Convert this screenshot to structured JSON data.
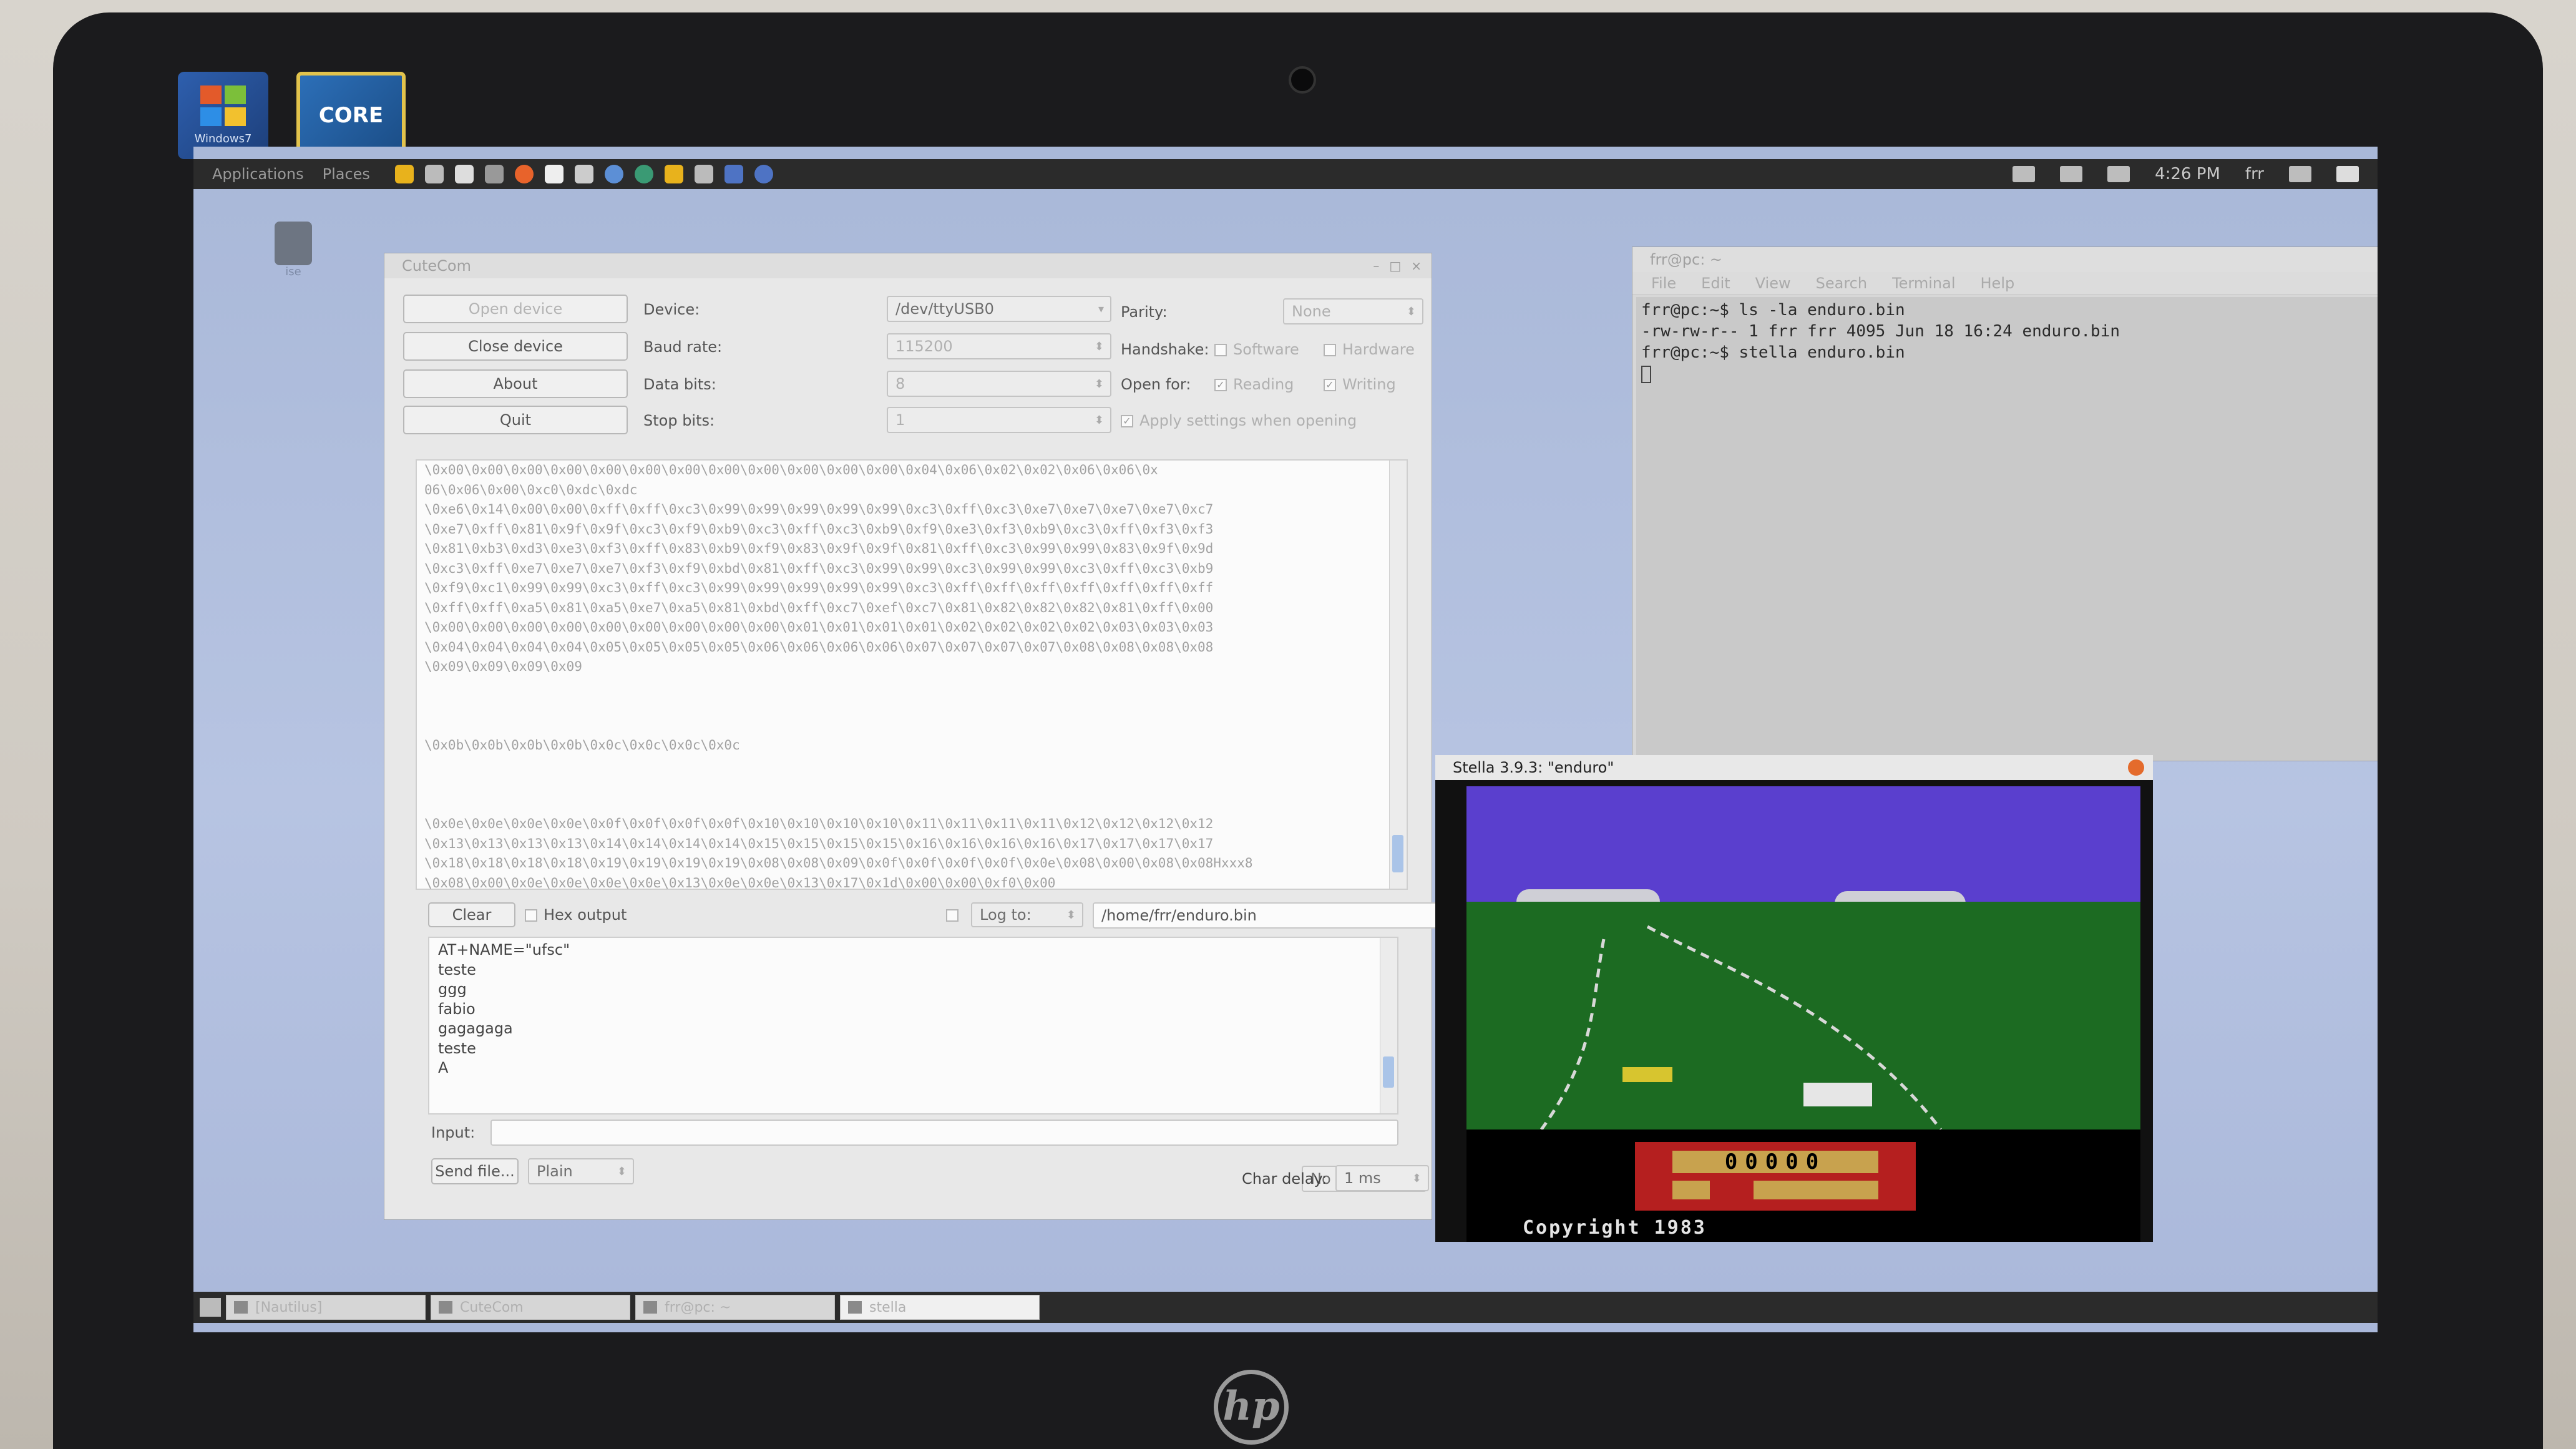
{
  "taskbar_top": {
    "applications": "Applications",
    "places": "Places",
    "clock": "4:26 PM",
    "user": "frr"
  },
  "desktop": {
    "windows7_label": "Windows7",
    "intel_label": "CORE",
    "desk_icon_label": "ise"
  },
  "cutecom": {
    "title": "CuteCom",
    "buttons": {
      "open_device": "Open device",
      "close_device": "Close device",
      "about": "About",
      "quit": "Quit"
    },
    "labels": {
      "device": "Device:",
      "baud_rate": "Baud rate:",
      "data_bits": "Data bits:",
      "stop_bits": "Stop bits:",
      "parity": "Parity:",
      "handshake": "Handshake:",
      "open_for": "Open for:"
    },
    "values": {
      "device": "/dev/ttyUSB0",
      "baud_rate": "115200",
      "data_bits": "8",
      "stop_bits": "1",
      "parity": "None"
    },
    "checkboxes": {
      "software": "Software",
      "hardware": "Hardware",
      "reading": "Reading",
      "writing": "Writing",
      "apply_settings": "Apply settings when opening"
    },
    "output_lines": [
      "\\0x00\\0x00\\0x00\\0x00\\0x00\\0x00\\0x00\\0x00\\0x00\\0x00\\0x00\\0x00\\0x04\\0x06\\0x02\\0x02\\0x06\\0x06\\0x",
      "06\\0x06\\0x00\\0xc0\\0xdc\\0xdc",
      "\\0xe6\\0x14\\0x00\\0x00\\0xff\\0xff\\0xc3\\0x99\\0x99\\0x99\\0x99\\0x99\\0xc3\\0xff\\0xc3\\0xe7\\0xe7\\0xe7\\0xe7\\0xc7",
      "\\0xe7\\0xff\\0x81\\0x9f\\0x9f\\0xc3\\0xf9\\0xb9\\0xc3\\0xff\\0xc3\\0xb9\\0xf9\\0xe3\\0xf3\\0xb9\\0xc3\\0xff\\0xf3\\0xf3",
      "\\0x81\\0xb3\\0xd3\\0xe3\\0xf3\\0xff\\0x83\\0xb9\\0xf9\\0x83\\0x9f\\0x9f\\0x81\\0xff\\0xc3\\0x99\\0x99\\0x83\\0x9f\\0x9d",
      "\\0xc3\\0xff\\0xe7\\0xe7\\0xe7\\0xf3\\0xf9\\0xbd\\0x81\\0xff\\0xc3\\0x99\\0x99\\0xc3\\0x99\\0x99\\0xc3\\0xff\\0xc3\\0xb9",
      "\\0xf9\\0xc1\\0x99\\0x99\\0xc3\\0xff\\0xc3\\0x99\\0x99\\0x99\\0x99\\0x99\\0xc3\\0xff\\0xff\\0xff\\0xff\\0xff\\0xff\\0xff",
      "\\0xff\\0xff\\0xa5\\0x81\\0xa5\\0xe7\\0xa5\\0x81\\0xbd\\0xff\\0xc7\\0xef\\0xc7\\0x81\\0x82\\0x82\\0x82\\0x81\\0xff\\0x00",
      "\\0x00\\0x00\\0x00\\0x00\\0x00\\0x00\\0x00\\0x00\\0x00\\0x01\\0x01\\0x01\\0x01\\0x02\\0x02\\0x02\\0x02\\0x03\\0x03\\0x03",
      "\\0x04\\0x04\\0x04\\0x04\\0x05\\0x05\\0x05\\0x05\\0x06\\0x06\\0x06\\0x06\\0x07\\0x07\\0x07\\0x07\\0x08\\0x08\\0x08\\0x08",
      "\\0x09\\0x09\\0x09\\0x09",
      "",
      "",
      "",
      "\\0x0b\\0x0b\\0x0b\\0x0b\\0x0c\\0x0c\\0x0c\\0x0c",
      "",
      "",
      "",
      "\\0x0e\\0x0e\\0x0e\\0x0e\\0x0f\\0x0f\\0x0f\\0x0f\\0x10\\0x10\\0x10\\0x10\\0x11\\0x11\\0x11\\0x11\\0x12\\0x12\\0x12\\0x12",
      "\\0x13\\0x13\\0x13\\0x13\\0x14\\0x14\\0x14\\0x14\\0x15\\0x15\\0x15\\0x15\\0x16\\0x16\\0x16\\0x16\\0x17\\0x17\\0x17\\0x17",
      "\\0x18\\0x18\\0x18\\0x18\\0x19\\0x19\\0x19\\0x19\\0x08\\0x08\\0x09\\0x0f\\0x0f\\0x0f\\0x0f\\0x0e\\0x08\\0x00\\0x08\\0x08Hxxx8",
      "\\0x08\\0x00\\0x0e\\0x0e\\0x0e\\0x0e\\0x13\\0x0e\\0x0e\\0x13\\0x17\\0x1d\\0x00\\0x00\\0xf0\\0x00"
    ],
    "clear": "Clear",
    "hex_output": "Hex output",
    "log_to": "Log to:",
    "log_path": "/home/frr/enduro.bin",
    "browse": "...",
    "sent_history": [
      "AT+NAME=\"ufsc\"",
      "teste",
      "ggg",
      "fabio",
      "gagagaga",
      "teste",
      "A"
    ],
    "input_label": "Input:",
    "input_value": "",
    "send_file": "Send file...",
    "send_mode": "Plain",
    "line_end": "No line end",
    "char_delay_label": "Char delay:",
    "char_delay": "1 ms"
  },
  "terminal": {
    "title": "frr@pc: ~",
    "menu": [
      "File",
      "Edit",
      "View",
      "Search",
      "Terminal",
      "Help"
    ],
    "lines": [
      "frr@pc:~$ ls -la enduro.bin",
      "-rw-rw-r-- 1 frr frr 4095 Jun 18 16:24 enduro.bin",
      "frr@pc:~$ stella enduro.bin"
    ]
  },
  "stella": {
    "title": "Stella 3.9.3: \"enduro\"",
    "score": "00000",
    "copyright": "Copyright 1983"
  },
  "taskbar_bottom": {
    "items": [
      "[Nautilus]",
      "CuteCom",
      "frr@pc: ~",
      "stella"
    ]
  },
  "colors": {
    "sky": "#5a3fce",
    "grass": "#1c6b22",
    "score_panel": "#b51f1f"
  }
}
